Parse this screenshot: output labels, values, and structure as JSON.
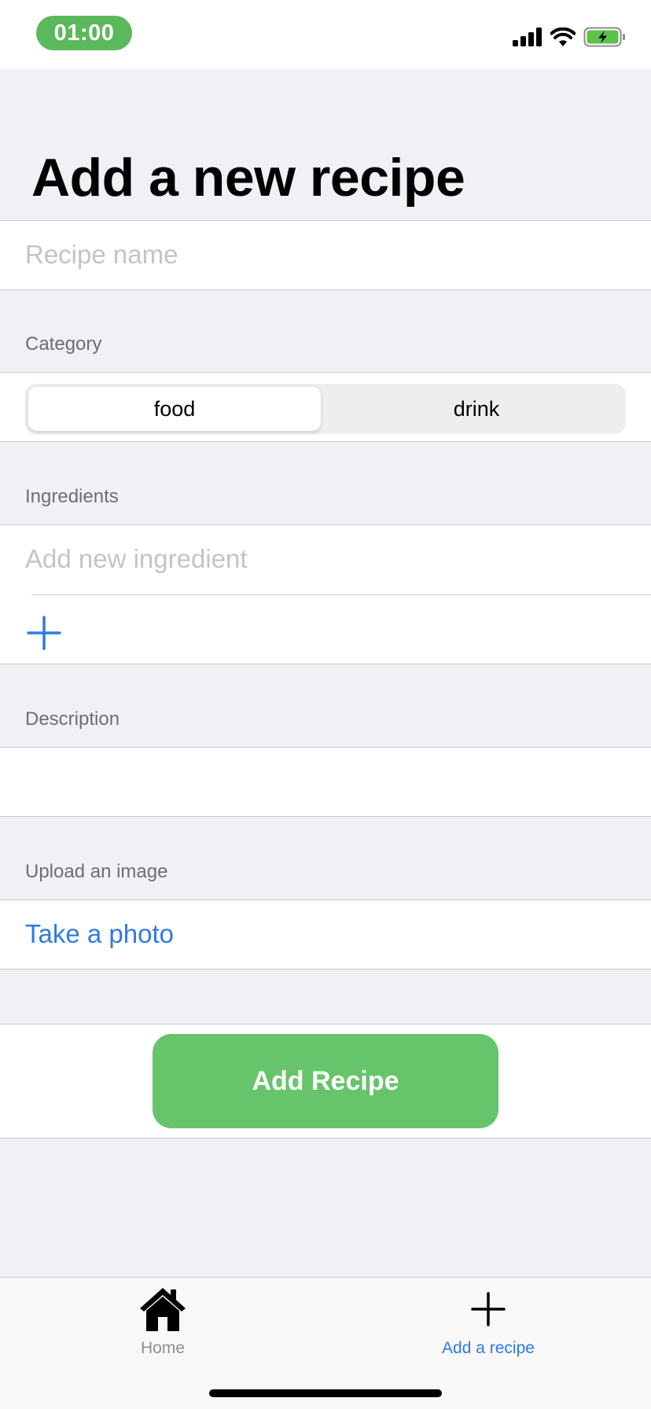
{
  "status_bar": {
    "time": "01:00",
    "icons": [
      "cellular-signal-icon",
      "wifi-icon",
      "battery-charging-icon"
    ],
    "time_pill_color": "#5cb85c",
    "battery_color": "#5cc24a"
  },
  "title": "Add a new recipe",
  "recipe_name": {
    "placeholder": "Recipe name",
    "value": ""
  },
  "category": {
    "header": "Category",
    "options": [
      "food",
      "drink"
    ],
    "selected": "food"
  },
  "ingredients": {
    "header": "Ingredients",
    "placeholder": "Add new ingredient",
    "value": "",
    "add_icon": "plus-icon"
  },
  "description": {
    "header": "Description",
    "value": ""
  },
  "image": {
    "header": "Upload an image",
    "take_photo_label": "Take a photo"
  },
  "submit_label": "Add Recipe",
  "tab_bar": {
    "items": [
      {
        "label": "Home",
        "icon": "house-icon",
        "active": false
      },
      {
        "label": "Add a recipe",
        "icon": "plus-icon",
        "active": true
      }
    ]
  },
  "colors": {
    "accent": "#2f7ae5",
    "submit_button": "#66c56a",
    "background": "#f0f0f5"
  }
}
